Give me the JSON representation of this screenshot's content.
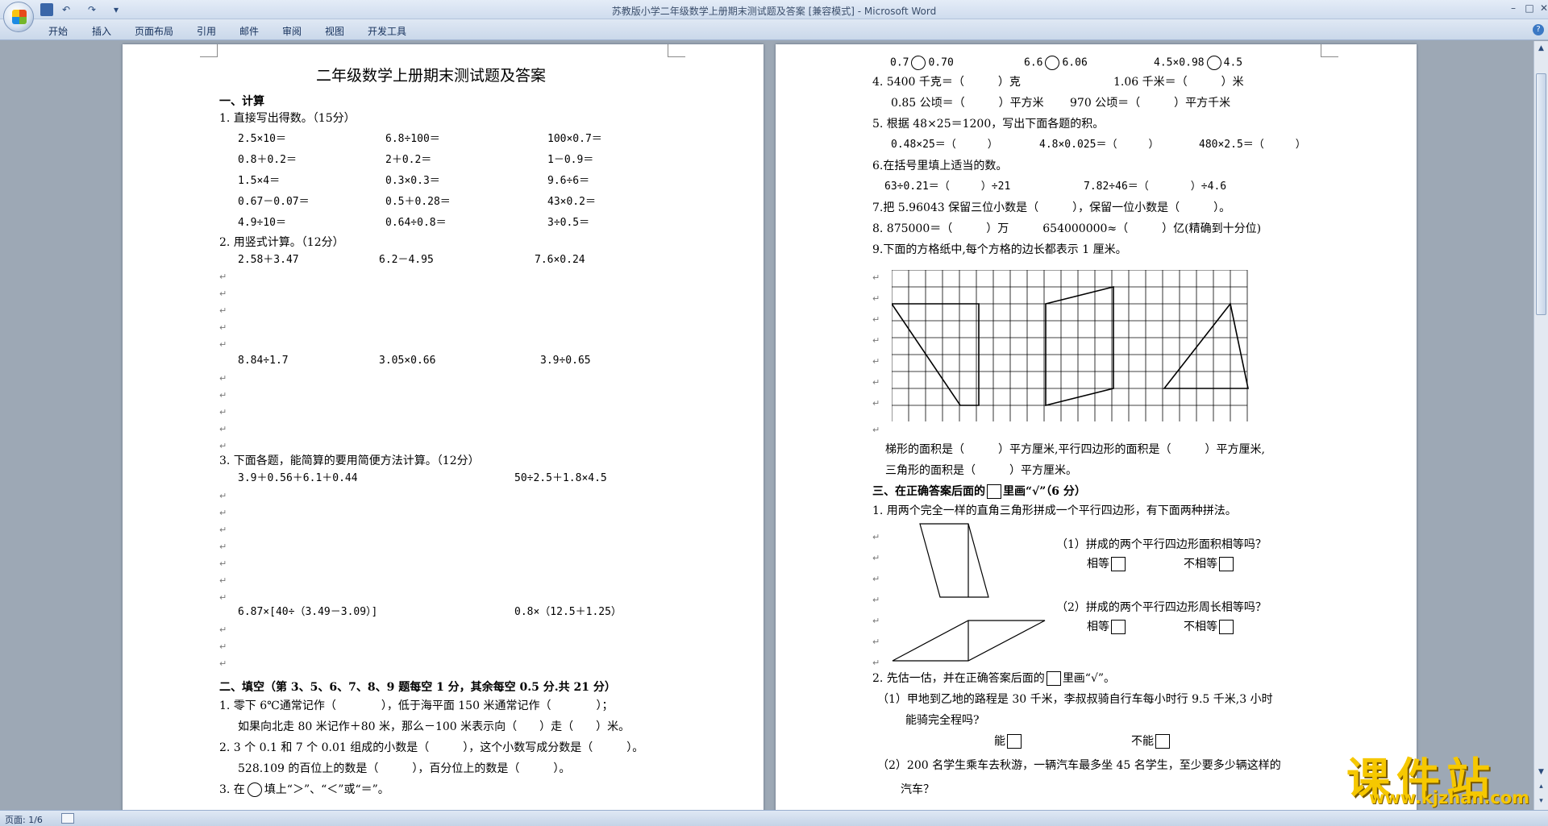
{
  "window": {
    "title": "苏教版小学二年级数学上册期末测试题及答案 [兼容模式] - Microsoft Word",
    "minimize": "–",
    "maximize": "□",
    "close": "✕"
  },
  "quick_access": {
    "undo": "↶",
    "redo": "↷",
    "more": "▾"
  },
  "ribbon": {
    "tabs": [
      "开始",
      "插入",
      "页面布局",
      "引用",
      "邮件",
      "审阅",
      "视图",
      "开发工具"
    ],
    "help": "?"
  },
  "status": {
    "page": "页面: 1/6"
  },
  "watermark": {
    "cn": "课件站",
    "url": "www.kjzhan.com"
  },
  "page1": {
    "title": "二年级数学上册期末测试题及答案",
    "sec1": "一、计算",
    "q1": "1. 直接写出得数。（15分）",
    "q1_rows": [
      [
        "2.5×10＝",
        "6.8÷100＝",
        "100×0.7＝"
      ],
      [
        "0.8＋0.2＝",
        "2＋0.2＝",
        "1－0.9＝"
      ],
      [
        "1.5×4＝",
        "0.3×0.3＝",
        "9.6÷6＝"
      ],
      [
        "0.67－0.07＝",
        "0.5＋0.28＝",
        "43×0.2＝"
      ],
      [
        "4.9÷10＝",
        "0.64÷0.8＝",
        "3÷0.5＝"
      ]
    ],
    "q2": "2. 用竖式计算。（12分）",
    "q2_row1": [
      "2.58＋3.47",
      "6.2－4.95",
      "7.6×0.24"
    ],
    "q2_row2": [
      "8.84÷1.7",
      "3.05×0.66",
      "3.9÷0.65"
    ],
    "q3": "3. 下面各题，能简算的要用简便方法计算。（12分）",
    "q3_row1": [
      "3.9＋0.56＋6.1＋0.44",
      "50÷2.5＋1.8×4.5"
    ],
    "q3_row2": [
      "6.87×[40÷（3.49－3.09）]",
      "0.8×（12.5＋1.25）"
    ],
    "sec2": "二、填空（第 3、5、6、7、8、9 题每空 1 分，其余每空 0.5 分.共 21 分）",
    "f1a": "1. 零下 6℃通常记作（　　　　），低于海平面 150 米通常记作（　　　　）；",
    "f1b": "如果向北走 80 米记作＋80 米，那么－100 米表示向（　　）走（　　）米。",
    "f2a": "2. 3 个 0.1 和 7 个 0.01 组成的小数是（　　　），这个小数写成分数是（　　　）。",
    "f2b": "528.109 的百位上的数是（　　　），百分位上的数是（　　　）。",
    "f3_pre": "3. 在",
    "f3_post": "填上“＞”、“＜”或“＝”。"
  },
  "page2": {
    "cmp": [
      {
        "a": "0.7",
        "b": "0.70"
      },
      {
        "a": "6.6",
        "b": "6.06"
      },
      {
        "a": "4.5×0.98",
        "b": "4.5"
      }
    ],
    "f4a": [
      "4. 5400 千克＝（　　　）克",
      "1.06 千米＝（　　　）米"
    ],
    "f4b": [
      "0.85 公顷＝（　　　）平方米",
      "970 公顷＝（　　　）平方千米"
    ],
    "f5": "5. 根据 48×25＝1200，写出下面各题的积。",
    "f5_row": [
      "0.48×25＝（　　　）",
      "4.8×0.025＝（　　　）",
      "480×2.5＝（　　　）"
    ],
    "f6": "6.在括号里填上适当的数。",
    "f6_row": [
      "63÷0.21＝（　　　）÷21",
      "7.82÷46＝（　　　　）÷4.6"
    ],
    "f7": "7.把 5.96043 保留三位小数是（　　　），保留一位小数是（　　　）。",
    "f8": "8. 875000＝（　　　）万　　　654000000≈（　　　）亿(精确到十分位)",
    "f9": "9.下面的方格纸中,每个方格的边长都表示 1 厘米。",
    "f9_ans1": "梯形的面积是（　　　）平方厘米,平行四边形的面积是（　　　）平方厘米,",
    "f9_ans2": "三角形的面积是（　　　）平方厘米。",
    "sec3_pre": "三、在正确答案后面的",
    "sec3_post": "里画“√”（6 分）",
    "t1": "1. 用两个完全一样的直角三角形拼成一个平行四边形，有下面两种拼法。",
    "t1_q1": "（1）拼成的两个平行四边形面积相等吗？",
    "t1_q2": "（2）拼成的两个平行四边形周长相等吗？",
    "equal": "相等",
    "not_equal": "不相等",
    "t2_pre": "2. 先估一估，并在正确答案后面的",
    "t2_post": "里画“√”。",
    "t2_q1a": "（1）甲地到乙地的路程是 30 千米，李叔叔骑自行车每小时行 9.5 千米,3 小时",
    "t2_q1b": "能骑完全程吗?",
    "can": "能",
    "cannot": "不能",
    "t2_q2a": "（2）200 名学生乘车去秋游，一辆汽车最多坐 45 名学生，至少要多少辆这样的",
    "t2_q2b": "汽车？"
  }
}
